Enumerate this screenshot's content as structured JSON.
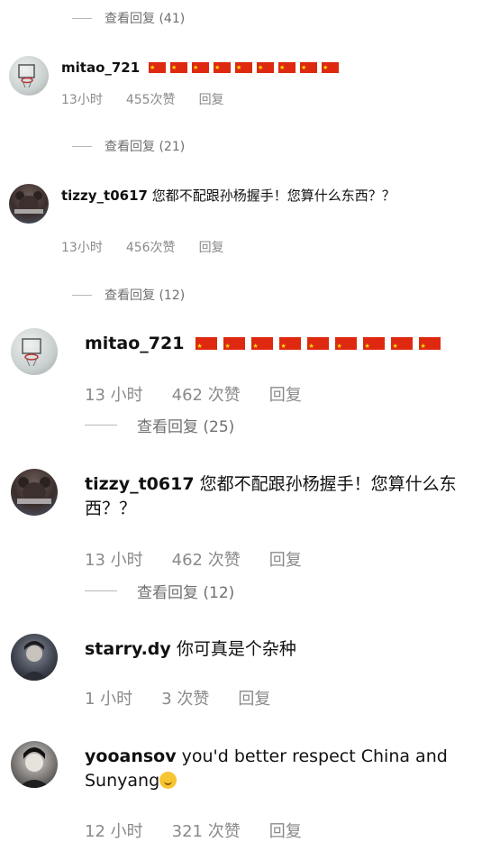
{
  "comments": [
    {
      "user": "mitao_721",
      "text": "",
      "time": "13小时",
      "likes": "455次赞",
      "reply": "回复",
      "view_replies": "查看回复 (21)",
      "flags": 9
    },
    {
      "user": "tizzy_t0617",
      "text": "您都不配跟孙杨握手！您算什么东西？？",
      "time": "13小时",
      "likes": "456次赞",
      "reply": "回复",
      "view_replies": "查看回复 (12)"
    },
    {
      "user": "mitao_721",
      "text": "",
      "time": "13 小时",
      "likes": "462 次赞",
      "reply": "回复",
      "view_replies": "查看回复 (25)",
      "flags": 9
    },
    {
      "user": "tizzy_t0617",
      "text": "您都不配跟孙杨握手！您算什么东西？？",
      "time": "13 小时",
      "likes": "462 次赞",
      "reply": "回复",
      "view_replies": "查看回复 (12)"
    },
    {
      "user": "starry.dy",
      "text": "你可真是个杂种",
      "time": "1 小时",
      "likes": "3 次赞",
      "reply": "回复"
    },
    {
      "user": "yooansov",
      "text": "you'd better respect China and Sunyang",
      "time": "12 小时",
      "likes": "321 次赞",
      "reply": "回复",
      "emoji": "upside-down-face-emoji"
    }
  ],
  "top_view_replies": "查看回复 (41)",
  "colors": {
    "flag": "#de2910",
    "star": "#ffde00",
    "meta": "#8a8a8a"
  }
}
